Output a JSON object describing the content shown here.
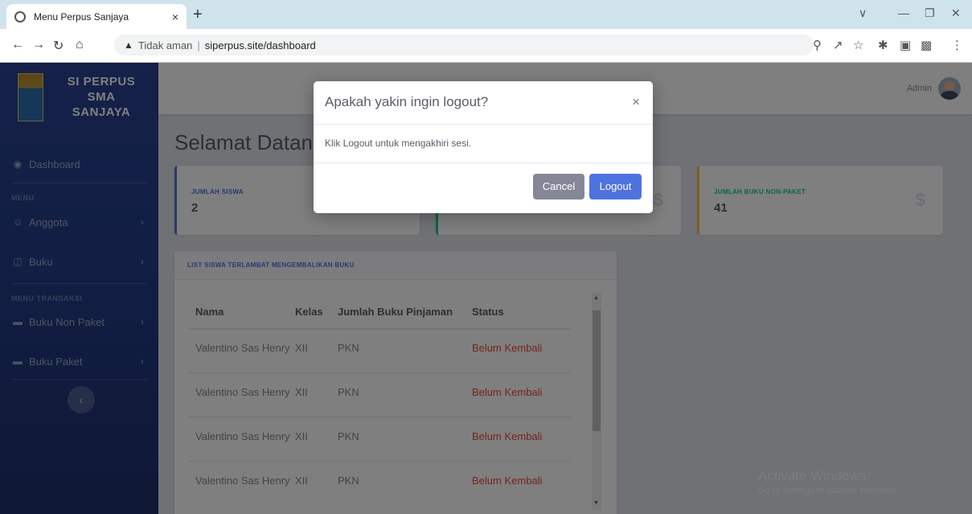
{
  "browser": {
    "tab_title": "Menu Perpus Sanjaya",
    "tab_close": "×",
    "new_tab": "+",
    "security_warning": "Tidak aman",
    "separator": "|",
    "url": "siperpus.site/dashboard"
  },
  "sidebar": {
    "brand": [
      "SI PERPUS",
      "SMA",
      "SANJAYA"
    ],
    "dashboard_label": "Dashboard",
    "heading_menu": "MENU",
    "anggota_label": "Anggota",
    "buku_label": "Buku",
    "heading_transaksi": "MENU TRANSAKSI",
    "buku_non_paket_label": "Buku Non Paket",
    "buku_paket_label": "Buku Paket"
  },
  "topbar": {
    "user_name": "Admin"
  },
  "main": {
    "welcome": "Selamat Datang",
    "cards": [
      {
        "label": "JUMLAH SISWA",
        "value": "2",
        "color": "#4e73df"
      },
      {
        "label": "",
        "value": "",
        "color": "#1cc88a"
      },
      {
        "label": "JUMLAH BUKU NON-PAKET",
        "value": "41",
        "color": "#f6c23e"
      }
    ],
    "card_icon": "$",
    "list_title": "LIST SISWA TERLAMBAT MENGEMBALIKAN BUKU",
    "table": {
      "headers": [
        "Nama",
        "Kelas",
        "Jumlah Buku Pinjaman",
        "Status"
      ],
      "rows": [
        [
          "Valentino Sas Henry",
          "XII",
          "PKN",
          "Belum Kembali"
        ],
        [
          "Valentino Sas Henry",
          "XII",
          "PKN",
          "Belum Kembali"
        ],
        [
          "Valentino Sas Henry",
          "XII",
          "PKN",
          "Belum Kembali"
        ],
        [
          "Valentino Sas Henry",
          "XII",
          "PKN",
          "Belum Kembali"
        ]
      ]
    }
  },
  "watermark": {
    "title": "Activate Windows",
    "subtitle": "Go to Settings to activate Windows."
  },
  "modal": {
    "title": "Apakah yakin ingin logout?",
    "close": "×",
    "body": "Klik Logout untuk mengakhiri sesi.",
    "cancel_label": "Cancel",
    "logout_label": "Logout"
  }
}
